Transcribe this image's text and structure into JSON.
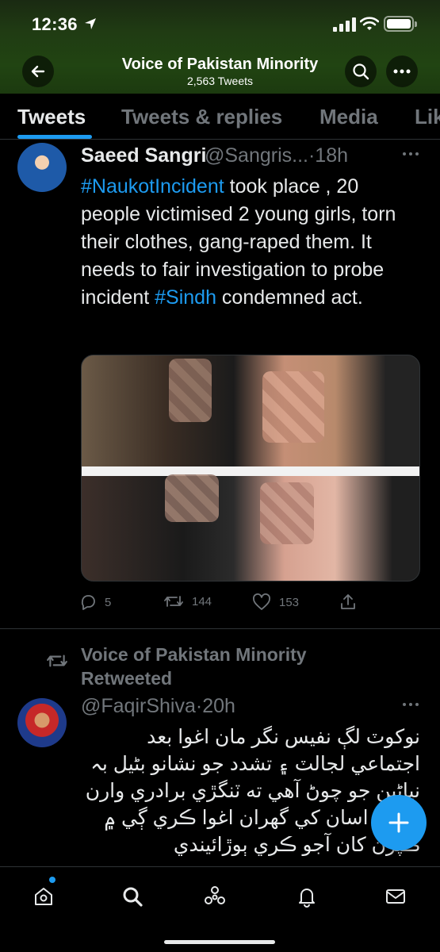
{
  "status_bar": {
    "time": "12:36"
  },
  "header": {
    "title": "Voice of Pakistan Minority",
    "subtitle": "2,563 Tweets"
  },
  "tabs": [
    {
      "label": "Tweets",
      "active": true
    },
    {
      "label": "Tweets & replies",
      "active": false
    },
    {
      "label": "Media",
      "active": false
    },
    {
      "label": "Lik",
      "active": false
    }
  ],
  "tweet1": {
    "name": "Saeed Sangri",
    "handle": "@Sangris...",
    "time": "·18h",
    "text_parts": [
      {
        "text": "#NaukotIncident",
        "tag": true
      },
      {
        "text": " took place , 20 people victimised 2 young girls, torn their clothes, gang-raped them. It needs to fair investigation to probe incident ",
        "tag": false
      },
      {
        "text": "#Sindh",
        "tag": true
      },
      {
        "text": " condemned act.",
        "tag": false
      }
    ],
    "replies": "5",
    "retweets": "144",
    "likes": "153"
  },
  "tweet2": {
    "retweet_label": "Voice of Pakistan Minority Retweeted",
    "handle": "@FaqirShiva",
    "time": "·20h",
    "text": "نوکوٽ لڳ نفيس نگر مان اغوا بعد اجتماعي لجالٽ ۽ تشدد جو نشانو بڻيل بہ نياڻين جو چوڻ آهي ته ٽنگڙي برادري وارن ماڻهن اسان کي گهران اغوا ڪري ڳي ۾ ڪپڙن کان آجو ڪري ٻوڙائيندي"
  },
  "colors": {
    "accent": "#1d9bf0",
    "text": "#e7e9ea",
    "muted": "#71767b",
    "banner": "#214412"
  },
  "icons": {
    "back": "arrow-left-icon",
    "search": "search-icon",
    "more": "more-horizontal-icon",
    "reply": "reply-icon",
    "retweet": "retweet-icon",
    "like": "heart-icon",
    "share": "share-icon",
    "compose": "plus-icon",
    "nav": [
      "home-icon",
      "explore-icon",
      "spaces-icon",
      "notifications-icon",
      "messages-icon"
    ]
  }
}
